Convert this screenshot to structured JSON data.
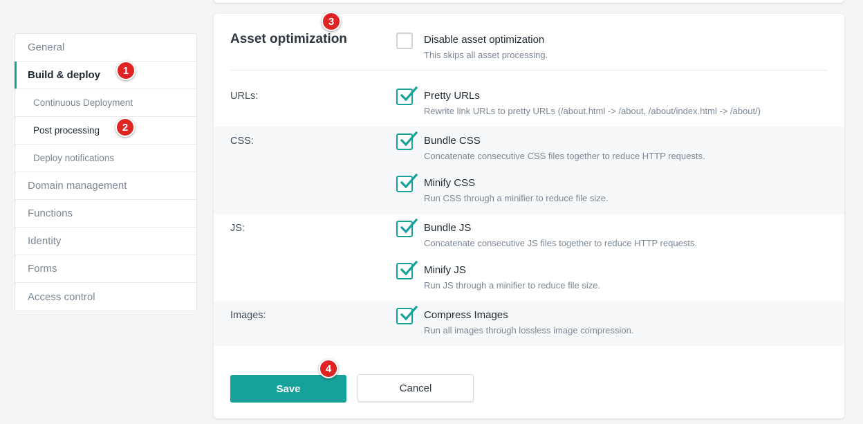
{
  "sidebar": {
    "items": [
      {
        "label": "General"
      },
      {
        "label": "Build & deploy"
      },
      {
        "label": "Continuous Deployment"
      },
      {
        "label": "Post processing"
      },
      {
        "label": "Deploy notifications"
      },
      {
        "label": "Domain management"
      },
      {
        "label": "Functions"
      },
      {
        "label": "Identity"
      },
      {
        "label": "Forms"
      },
      {
        "label": "Access control"
      }
    ]
  },
  "badges": [
    "1",
    "2",
    "3",
    "4"
  ],
  "asset_optimization": {
    "title": "Asset optimization",
    "disable": {
      "label": "Disable asset optimization",
      "desc": "This skips all asset processing.",
      "checked": false
    },
    "urls": {
      "row_label": "URLs:",
      "pretty_urls": {
        "label": "Pretty URLs",
        "desc": "Rewrite link URLs to pretty URLs (/about.html -> /about, /about/index.html -> /about/)",
        "checked": true
      }
    },
    "css": {
      "row_label": "CSS:",
      "bundle": {
        "label": "Bundle CSS",
        "desc": "Concatenate consecutive CSS files together to reduce HTTP requests.",
        "checked": true
      },
      "minify": {
        "label": "Minify CSS",
        "desc": "Run CSS through a minifier to reduce file size.",
        "checked": true
      }
    },
    "js": {
      "row_label": "JS:",
      "bundle": {
        "label": "Bundle JS",
        "desc": "Concatenate consecutive JS files together to reduce HTTP requests.",
        "checked": true
      },
      "minify": {
        "label": "Minify JS",
        "desc": "Run JS through a minifier to reduce file size.",
        "checked": true
      }
    },
    "images": {
      "row_label": "Images:",
      "compress": {
        "label": "Compress Images",
        "desc": "Run all images through lossless image compression.",
        "checked": true
      }
    }
  },
  "actions": {
    "save_label": "Save",
    "cancel_label": "Cancel"
  },
  "colors": {
    "accent": "#15a29a",
    "badge": "#e02424"
  },
  "icons": {
    "checkbox_checked": "checkmark-icon"
  }
}
